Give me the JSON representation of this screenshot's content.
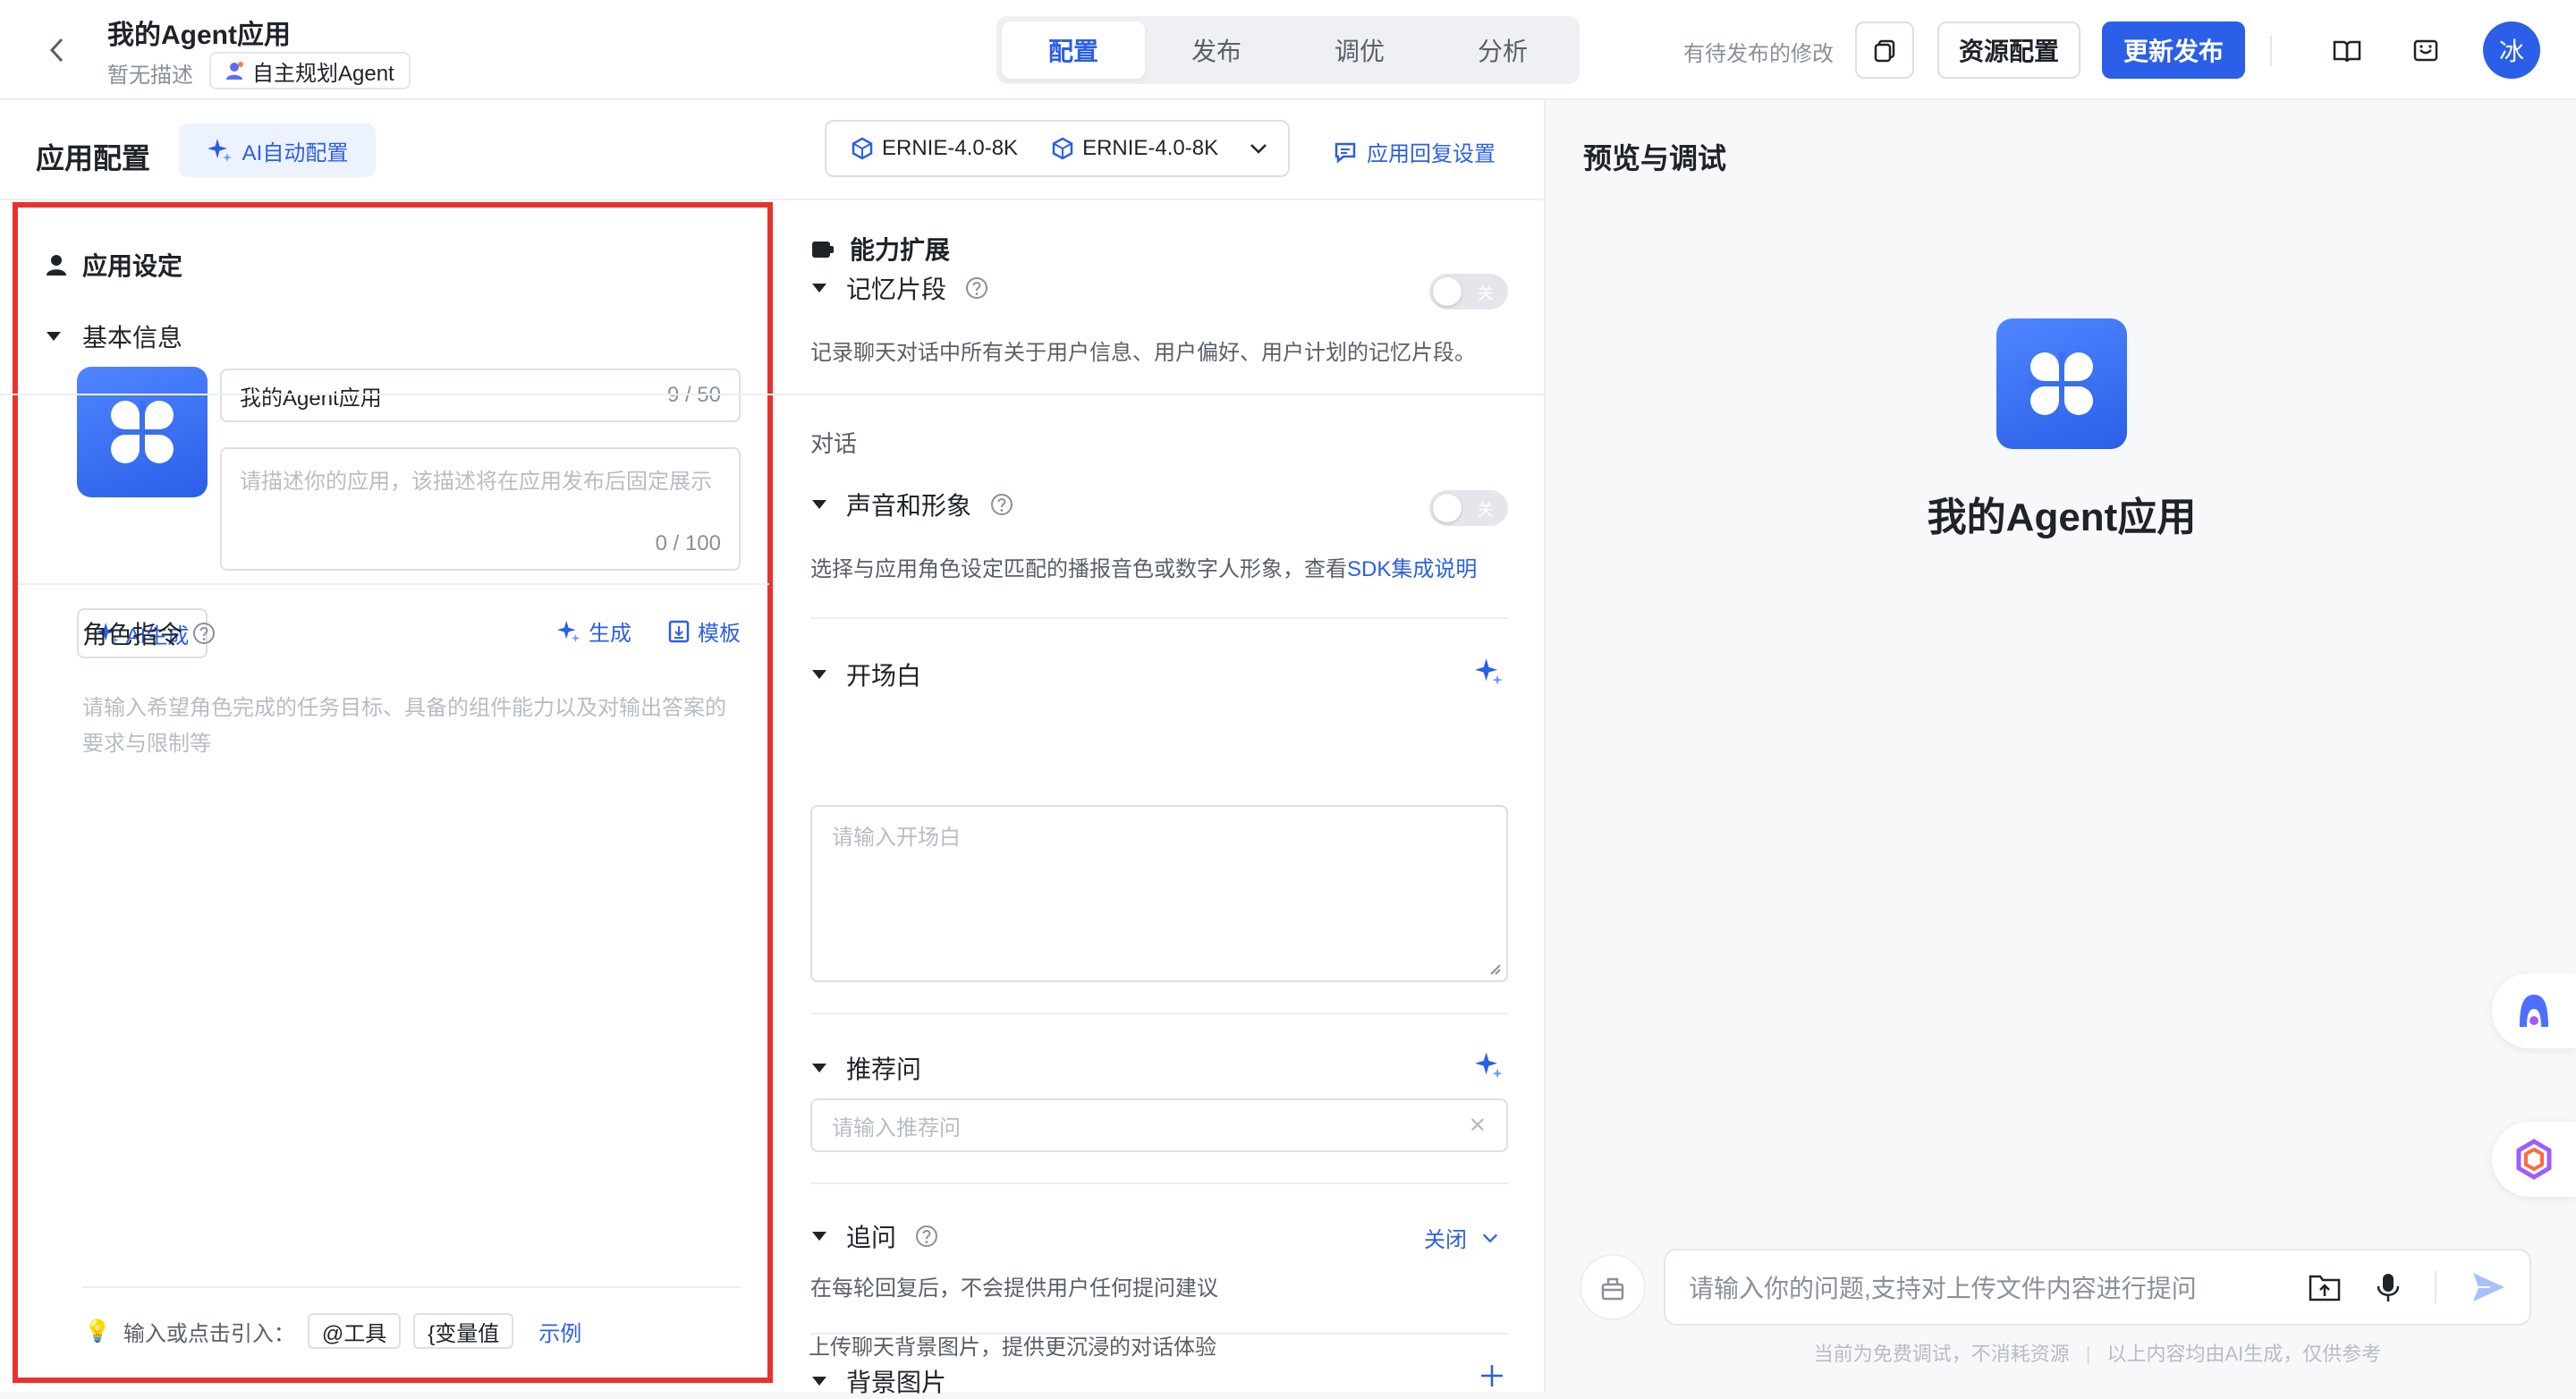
{
  "header": {
    "app_title": "我的Agent应用",
    "app_desc": "暂无描述",
    "agent_type": "自主规划Agent",
    "tabs": [
      {
        "label": "配置",
        "active": true
      },
      {
        "label": "发布",
        "active": false
      },
      {
        "label": "调优",
        "active": false
      },
      {
        "label": "分析",
        "active": false
      }
    ],
    "pending": "有待发布的修改",
    "resource_btn": "资源配置",
    "publish_btn": "更新发布",
    "avatar_char": "冰"
  },
  "config": {
    "title": "应用配置",
    "ai_auto": "AI自动配置",
    "models": [
      "ERNIE-4.0-8K",
      "ERNIE-4.0-8K"
    ],
    "reply_settings": "应用回复设置",
    "app_setting": "应用设定",
    "basic_info": "基本信息",
    "name_value": "我的Agent应用",
    "name_count": "9 / 50",
    "desc_placeholder": "请描述你的应用，该描述将在应用发布后固定展示",
    "desc_count": "0 / 100",
    "ai_generate": "AI生成",
    "role_title": "角色指令",
    "role_generate": "生成",
    "role_template": "模板",
    "role_placeholder": "请输入希望角色完成的任务目标、具备的组件能力以及对输出答案的要求与限制等",
    "ref_label": "输入或点击引入：",
    "ref_tool": "@工具",
    "ref_var": "{变量值",
    "ref_example": "示例"
  },
  "abilities": {
    "title": "能力扩展",
    "memory": {
      "label": "记忆片段",
      "toggle": "关",
      "desc": "记录聊天对话中所有关于用户信息、用户偏好、用户计划的记忆片段。"
    },
    "dialog_section": "对话",
    "voice": {
      "label": "声音和形象",
      "toggle": "关",
      "desc": "选择与应用角色设定匹配的播报音色或数字人形象，查看",
      "link": "SDK集成说明"
    },
    "opening": {
      "label": "开场白",
      "placeholder": "请输入开场白"
    },
    "recommend": {
      "label": "推荐问",
      "placeholder": "请输入推荐问"
    },
    "followup": {
      "label": "追问",
      "status": "关闭",
      "desc": "在每轮回复后，不会提供用户任何提问建议"
    },
    "background": {
      "label": "背景图片",
      "desc": "上传聊天背景图片，提供更沉浸的对话体验"
    }
  },
  "preview": {
    "title": "预览与调试",
    "app_name": "我的Agent应用",
    "input_placeholder": "请输入你的问题,支持对上传文件内容进行提问",
    "footer_left": "当前为免费调试，不消耗资源",
    "footer_right": "以上内容均由AI生成，仅供参考"
  },
  "colors": {
    "accent": "#2b5fe8",
    "highlight_border": "#e8322e"
  }
}
